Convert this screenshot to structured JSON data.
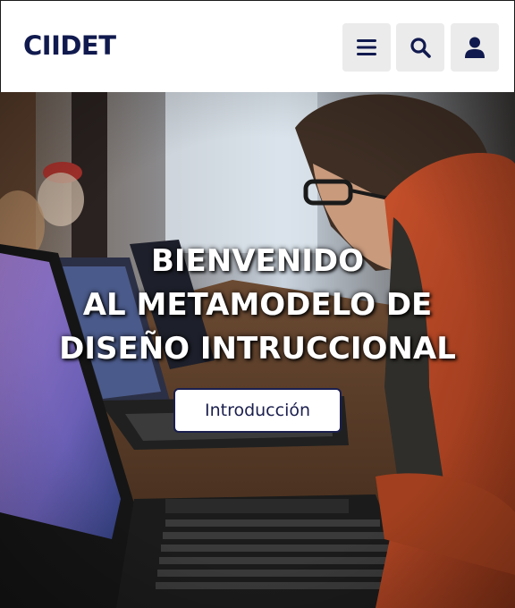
{
  "header": {
    "logo": "CIIDET",
    "menu_icon": "hamburger-menu-icon",
    "search_icon": "search-icon",
    "user_icon": "user-icon"
  },
  "hero": {
    "title_lines": [
      "BIENVENIDO",
      "AL METAMODELO DE",
      "DISEÑO INTRUCCIONAL"
    ],
    "button_label": "Introducción",
    "background": "photo-students-with-laptops"
  },
  "colors": {
    "brand_navy": "#111a4e",
    "header_button_bg": "#ebebeb",
    "hero_text": "#ffffff"
  }
}
